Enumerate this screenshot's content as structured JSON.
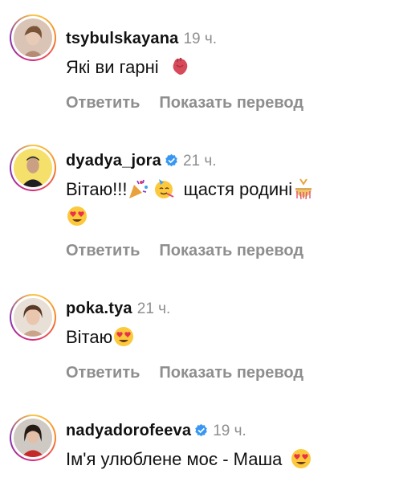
{
  "comments": [
    {
      "username": "tsybulskayana",
      "verified": false,
      "time": "19 ч.",
      "text": "Які ви гарні",
      "emojis": [
        "anatomical-heart"
      ]
    },
    {
      "username": "dyadya_jora",
      "verified": true,
      "time": "21 ч.",
      "text_part1": "Вітаю!!!",
      "text_part2": "щастя родині",
      "emojis": [
        "party-popper",
        "partying-face",
        "confetti-ball",
        "heart-eyes-face"
      ]
    },
    {
      "username": "poka.tya",
      "verified": false,
      "time": "21 ч.",
      "text": "Вітаю",
      "emojis": [
        "heart-eyes-face"
      ]
    },
    {
      "username": "nadyadorofeeva",
      "verified": true,
      "time": "19 ч.",
      "text": "Ім'я улюблене моє - Маша",
      "emojis": [
        "heart-eyes-face"
      ]
    }
  ],
  "actions": {
    "reply": "Ответить",
    "translate": "Показать перевод"
  },
  "colors": {
    "username": "#111111",
    "meta": "#8e8e8e",
    "verified": "#3897f0"
  }
}
